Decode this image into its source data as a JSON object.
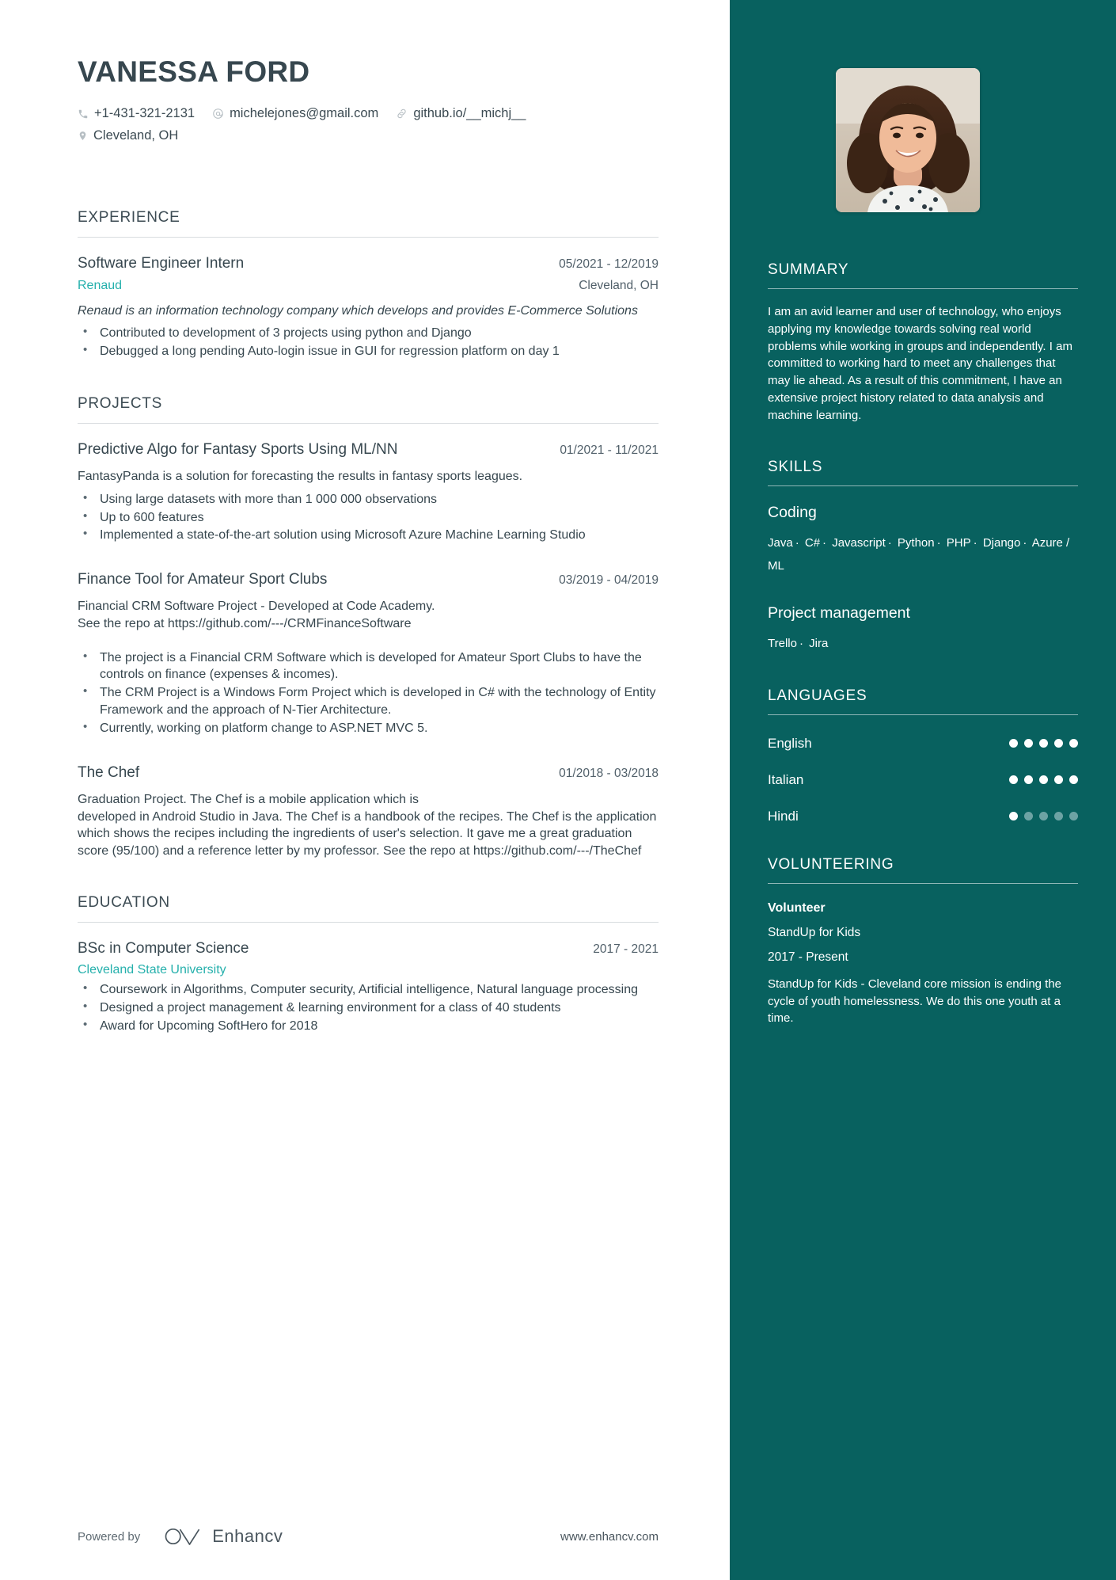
{
  "header": {
    "name": "VANESSA FORD",
    "contacts": [
      {
        "icon": "phone-icon",
        "text": "+1-431-321-2131"
      },
      {
        "icon": "email-icon",
        "text": "michelejones@gmail.com"
      },
      {
        "icon": "link-icon",
        "text": "github.io/__michj__"
      },
      {
        "icon": "location-pin-icon",
        "text": "Cleveland, OH"
      }
    ]
  },
  "experience": {
    "title": "EXPERIENCE",
    "entries": [
      {
        "role": "Software Engineer Intern",
        "date": "05/2021 - 12/2019",
        "org": "Renaud",
        "location": "Cleveland, OH",
        "summary": "Renaud is an information technology company which develops and provides E-Commerce Solutions",
        "bullets": [
          "Contributed to development of 3 projects using python and Django",
          "Debugged a long pending Auto-login issue in GUI for regression platform on day 1"
        ]
      }
    ]
  },
  "projects": {
    "title": "PROJECTS",
    "entries": [
      {
        "role": "Predictive Algo for Fantasy Sports Using ML/NN",
        "date": "01/2021 - 11/2021",
        "summary": "FantasyPanda is a solution for forecasting the results in fantasy sports leagues.",
        "bullets": [
          "Using large datasets with more than 1 000 000 observations",
          "Up to 600 features",
          "Implemented a state-of-the-art solution using Microsoft Azure Machine Learning Studio"
        ]
      },
      {
        "role": "Finance Tool for Amateur Sport Clubs",
        "date": "03/2019 - 04/2019",
        "summary": "Financial CRM Software Project - Developed at Code Academy.\nSee the repo at https://github.com/---/CRMFinanceSoftware",
        "bullets": [
          "The project is a Financial CRM Software which is developed for Amateur Sport Clubs to have the controls on finance (expenses & incomes).",
          "The CRM Project is a Windows Form Project which is developed in C# with the technology of Entity Framework and the approach of N-Tier Architecture.",
          "Currently, working on platform change to ASP.NET MVC 5."
        ]
      },
      {
        "role": "The Chef",
        "date": "01/2018 - 03/2018",
        "summary": "Graduation Project. The Chef is a mobile application which is\ndeveloped in Android Studio in Java. The Chef is a handbook of the recipes. The Chef is the application which shows the recipes including the ingredients of user's selection. It gave me a great graduation score (95/100) and a reference letter by my professor. See the repo at https://github.com/---/TheChef",
        "bullets": []
      }
    ]
  },
  "education": {
    "title": "EDUCATION",
    "entries": [
      {
        "degree": "BSc in Computer Science",
        "date": "2017 - 2021",
        "school": "Cleveland State University",
        "bullets": [
          "Coursework in Algorithms, Computer security, Artificial intelligence, Natural language processing",
          "Designed a project management & learning environment for a class of 40 students",
          "Award for Upcoming SoftHero for 2018"
        ]
      }
    ]
  },
  "footer": {
    "powered_by": "Powered by",
    "brand": "Enhancv",
    "url": "www.enhancv.com"
  },
  "sidebar": {
    "summary": {
      "title": "SUMMARY",
      "text": "I am an avid learner and user of technology, who enjoys applying my knowledge towards solving real world problems while working in groups and independently. I am committed to working hard to meet any challenges that may lie ahead. As a result of this commitment, I have an extensive project history related to data analysis and machine learning."
    },
    "skills": {
      "title": "SKILLS",
      "groups": [
        {
          "name": "Coding",
          "items": [
            "Java",
            "C#",
            "Javascript",
            "Python",
            "PHP",
            "Django",
            "Azure / ML"
          ]
        },
        {
          "name": "Project management",
          "items": [
            "Trello",
            "Jira"
          ]
        }
      ]
    },
    "languages": {
      "title": "LANGUAGES",
      "max": 5,
      "items": [
        {
          "name": "English",
          "level": 5
        },
        {
          "name": "Italian",
          "level": 5
        },
        {
          "name": "Hindi",
          "level": 1
        }
      ]
    },
    "volunteering": {
      "title": "VOLUNTEERING",
      "role": "Volunteer",
      "org": "StandUp for Kids",
      "date": "2017 - Present",
      "description": "StandUp for Kids - Cleveland core mission is ending the cycle of youth homelessness. We do this one youth at a time."
    }
  },
  "colors": {
    "sidebar_bg": "#08615f",
    "accent": "#25b0ac",
    "text": "#37474f"
  }
}
